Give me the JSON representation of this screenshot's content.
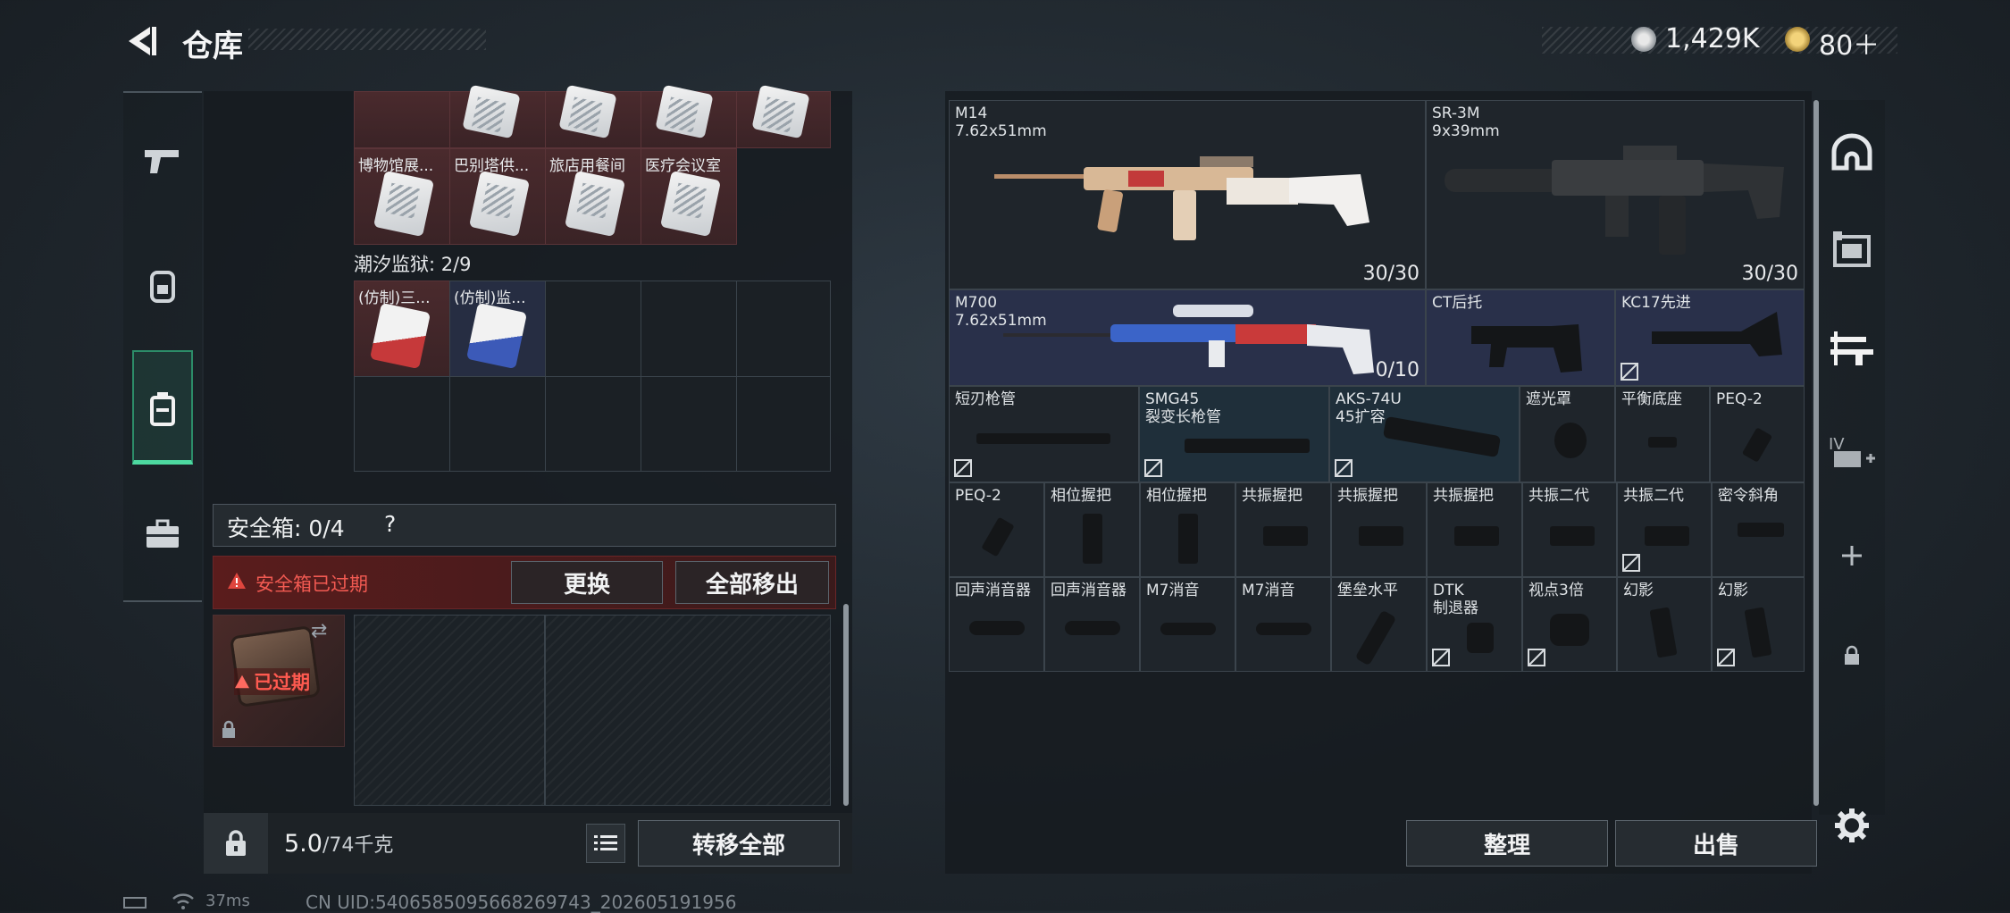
{
  "header": {
    "title": "仓库",
    "currency": {
      "coins": "1,429K",
      "tickets": "80＋"
    }
  },
  "left_sidebar": {
    "icons": [
      "pistol-icon",
      "backpack-icon",
      "case-icon",
      "briefcase-icon"
    ]
  },
  "storage": {
    "top_items": [
      "博物馆展...",
      "巴别塔供...",
      "旅店用餐间",
      "医疗会议室"
    ],
    "section_label": "潮汐监狱: 2/9",
    "section_items": [
      "(仿制)三...",
      "(仿制)监..."
    ]
  },
  "safe_box": {
    "label": "安全箱: 0/4",
    "help": "?",
    "warning": "安全箱已过期",
    "replace_button": "更换",
    "move_all_button": "全部移出",
    "expired_badge": "已过期"
  },
  "bottom_bar": {
    "weight_value": "5.0",
    "weight_unit": "/74千克",
    "transfer_all_button": "转移全部"
  },
  "weapons": {
    "large": [
      {
        "name": "M14",
        "caliber": "7.62x51mm",
        "ammo": "30/30"
      },
      {
        "name": "SR-3M",
        "caliber": "9x39mm",
        "ammo": "30/30"
      },
      {
        "name": "M700",
        "caliber": "7.62x51mm",
        "ammo": "0/10"
      }
    ],
    "stocks": [
      {
        "name": "CT后托"
      },
      {
        "name": "KC17先进"
      }
    ],
    "row3": [
      {
        "name": "短刃枪管"
      },
      {
        "name": "SMG45",
        "sub": "裂变长枪管"
      },
      {
        "name": "AKS-74U",
        "sub": "45扩容"
      },
      {
        "name": "遮光罩"
      },
      {
        "name": "平衡底座"
      },
      {
        "name": "PEQ-2"
      }
    ],
    "row4": [
      "PEQ-2",
      "相位握把",
      "相位握把",
      "共振握把",
      "共振握把",
      "共振握把",
      "共振二代",
      "共振二代",
      "密令斜角"
    ],
    "row5": [
      {
        "name": "回声消音器"
      },
      {
        "name": "回声消音器"
      },
      {
        "name": "M7消音"
      },
      {
        "name": "M7消音"
      },
      {
        "name": "堡垒水平"
      },
      {
        "name": "DTK",
        "sub": "制退器"
      },
      {
        "name": "视点3倍"
      },
      {
        "name": "幻影"
      },
      {
        "name": "幻影"
      }
    ]
  },
  "right_sidebar": {
    "icons": [
      "helmet-icon",
      "armor-icon",
      "weapon-rack-icon",
      "level-up-icon",
      "plus-icon",
      "lock-icon"
    ]
  },
  "actions": {
    "sort_button": "整理",
    "sell_button": "出售"
  },
  "status": {
    "ping": "37ms",
    "uid": "CN UID:5406585095668269743_202605191956"
  },
  "colors": {
    "accent": "#4dd9a0",
    "warning": "#e0463e",
    "panel": "#1b2025"
  }
}
